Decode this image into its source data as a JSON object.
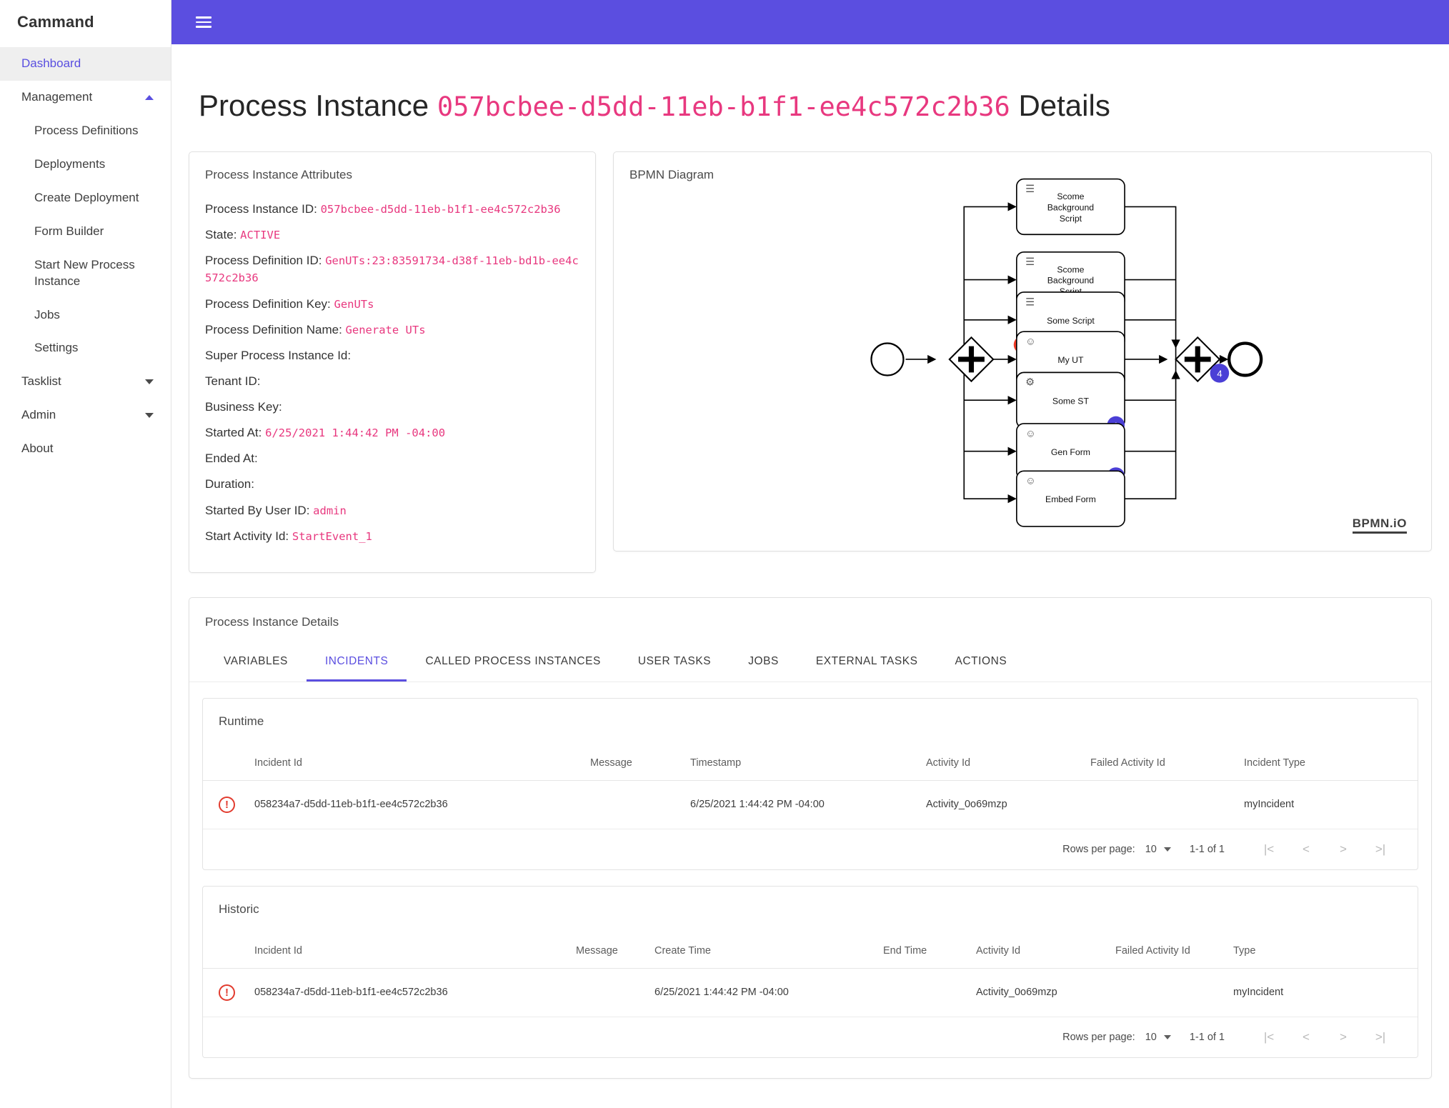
{
  "brand": "Cammand",
  "sidebar": {
    "items": [
      {
        "label": "Dashboard",
        "type": "link",
        "active": true
      },
      {
        "label": "Management",
        "type": "group",
        "caret": "up"
      },
      {
        "label": "Process Definitions",
        "type": "sub"
      },
      {
        "label": "Deployments",
        "type": "sub"
      },
      {
        "label": "Create Deployment",
        "type": "sub"
      },
      {
        "label": "Form Builder",
        "type": "sub"
      },
      {
        "label": "Start New Process Instance",
        "type": "sub"
      },
      {
        "label": "Jobs",
        "type": "sub"
      },
      {
        "label": "Settings",
        "type": "sub"
      },
      {
        "label": "Tasklist",
        "type": "group",
        "caret": "down"
      },
      {
        "label": "Admin",
        "type": "group",
        "caret": "down"
      },
      {
        "label": "About",
        "type": "link"
      }
    ]
  },
  "topbar": {
    "menu_icon": "hamburger-icon",
    "color": "#5b4ee0"
  },
  "page": {
    "title_prefix": "Process Instance",
    "title_id": "057bcbee-d5dd-11eb-b1f1-ee4c572c2b36",
    "title_suffix": "Details"
  },
  "attributes": {
    "card_label": "Process Instance Attributes",
    "rows": [
      {
        "label": "Process Instance ID:",
        "value": "057bcbee-d5dd-11eb-b1f1-ee4c572c2b36"
      },
      {
        "label": "State:",
        "value": "ACTIVE"
      },
      {
        "label": "Process Definition ID:",
        "value": "GenUTs:23:83591734-d38f-11eb-bd1b-ee4c572c2b36"
      },
      {
        "label": "Process Definition Key:",
        "value": "GenUTs"
      },
      {
        "label": "Process Definition Name:",
        "value": "Generate UTs"
      },
      {
        "label": "Super Process Instance Id:",
        "value": ""
      },
      {
        "label": "Tenant ID:",
        "value": ""
      },
      {
        "label": "Business Key:",
        "value": ""
      },
      {
        "label": "Started At:",
        "value": "6/25/2021 1:44:42 PM -04:00"
      },
      {
        "label": "Ended At:",
        "value": ""
      },
      {
        "label": "Duration:",
        "value": ""
      },
      {
        "label": "Started By User ID:",
        "value": "admin"
      },
      {
        "label": "Start Activity Id:",
        "value": "StartEvent_1"
      }
    ]
  },
  "bpmn": {
    "card_label": "BPMN Diagram",
    "logo": "BPMN.iO",
    "tasks": [
      {
        "name": "Scome Background Script",
        "icon": "script-task-icon",
        "badge": null
      },
      {
        "name": "Scome Background Script",
        "icon": "script-task-icon",
        "badge": null
      },
      {
        "name": "Some Script",
        "icon": "script-task-icon",
        "badge": "1",
        "badge_color": "#f03b26"
      },
      {
        "name": "My UT",
        "icon": "user-task-icon",
        "badge": "1",
        "badge_color": "#4b3fd6"
      },
      {
        "name": "Some ST",
        "icon": "service-task-icon",
        "badge": "1",
        "badge_color": "#4b3fd6"
      },
      {
        "name": "Gen Form",
        "icon": "user-task-icon",
        "badge": "1",
        "badge_color": "#4b3fd6"
      },
      {
        "name": "Embed Form",
        "icon": "user-task-icon",
        "badge": null
      }
    ],
    "gateway_join_badge": "4"
  },
  "details": {
    "card_label": "Process Instance Details",
    "tabs": [
      {
        "label": "VARIABLES",
        "active": false
      },
      {
        "label": "INCIDENTS",
        "active": true
      },
      {
        "label": "CALLED PROCESS INSTANCES",
        "active": false
      },
      {
        "label": "USER TASKS",
        "active": false
      },
      {
        "label": "JOBS",
        "active": false
      },
      {
        "label": "EXTERNAL TASKS",
        "active": false
      },
      {
        "label": "ACTIONS",
        "active": false
      }
    ],
    "runtime": {
      "title": "Runtime",
      "columns": [
        "",
        "Incident Id",
        "Message",
        "Timestamp",
        "Activity Id",
        "Failed Activity Id",
        "Incident Type"
      ],
      "rows": [
        {
          "icon": "error-icon",
          "incident_id": "058234a7-d5dd-11eb-b1f1-ee4c572c2b36",
          "message": "",
          "timestamp": "6/25/2021 1:44:42 PM -04:00",
          "activity_id": "Activity_0o69mzp",
          "failed_activity_id": "",
          "incident_type": "myIncident"
        }
      ],
      "paginator": {
        "rows_per_page_label": "Rows per page:",
        "rows_per_page_value": "10",
        "range": "1-1 of 1",
        "first": "|<",
        "prev": "<",
        "next": ">",
        "last": ">|"
      }
    },
    "historic": {
      "title": "Historic",
      "columns": [
        "",
        "Incident Id",
        "Message",
        "Create Time",
        "End Time",
        "Activity Id",
        "Failed Activity Id",
        "Type"
      ],
      "rows": [
        {
          "icon": "error-icon",
          "incident_id": "058234a7-d5dd-11eb-b1f1-ee4c572c2b36",
          "message": "",
          "create_time": "6/25/2021 1:44:42 PM -04:00",
          "end_time": "",
          "activity_id": "Activity_0o69mzp",
          "failed_activity_id": "",
          "type": "myIncident"
        }
      ],
      "paginator": {
        "rows_per_page_label": "Rows per page:",
        "rows_per_page_value": "10",
        "range": "1-1 of 1",
        "first": "|<",
        "prev": "<",
        "next": ">",
        "last": ">|"
      }
    }
  }
}
